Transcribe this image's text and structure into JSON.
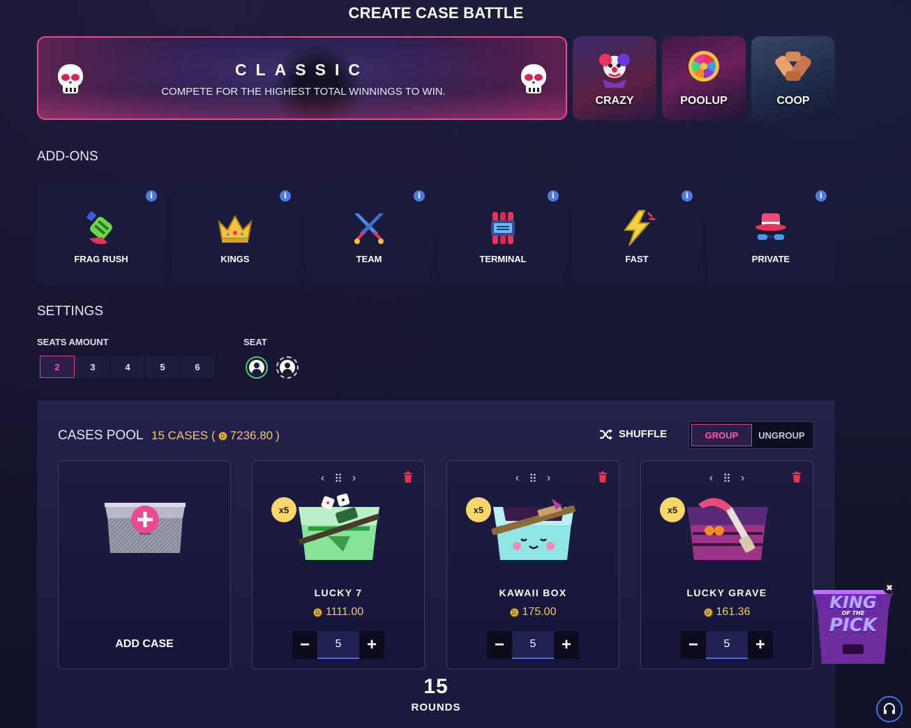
{
  "page": {
    "title": "CREATE CASE BATTLE"
  },
  "modes": {
    "classic": {
      "title": "CLASSIC",
      "subtitle": "COMPETE FOR THE HIGHEST TOTAL WINNINGS TO WIN."
    },
    "crazy": "CRAZY",
    "poolup": "POOLUP",
    "coop": "COOP"
  },
  "addons": {
    "heading": "ADD-ONS",
    "items": [
      {
        "label": "FRAG RUSH",
        "icon": "frag-rush-icon"
      },
      {
        "label": "KINGS",
        "icon": "crown-icon"
      },
      {
        "label": "TEAM",
        "icon": "crossed-swords-icon"
      },
      {
        "label": "TERMINAL",
        "icon": "terminal-bomb-icon"
      },
      {
        "label": "FAST",
        "icon": "lightning-icon"
      },
      {
        "label": "PRIVATE",
        "icon": "spy-hat-icon"
      }
    ],
    "info_glyph": "i"
  },
  "settings": {
    "heading": "SETTINGS",
    "seats_amount_label": "SEATS AMOUNT",
    "seat_label": "SEAT",
    "seat_options": [
      "2",
      "3",
      "4",
      "5",
      "6"
    ],
    "selected_seats": "2"
  },
  "pool": {
    "title": "CASES POOL",
    "count_prefix": "15 CASES (",
    "total": "7236.80",
    "count_suffix": ")",
    "shuffle_label": "SHUFFLE",
    "group_label": "GROUP",
    "ungroup_label": "UNGROUP",
    "add_case_label": "ADD CASE",
    "cases": [
      {
        "name": "LUCKY 7",
        "price": "1111.00",
        "multiplier": "x5",
        "quantity": "5",
        "accent": "#3cd65a"
      },
      {
        "name": "KAWAII BOX",
        "price": "175.00",
        "multiplier": "x5",
        "quantity": "5",
        "accent": "#5fd2d0"
      },
      {
        "name": "LUCKY GRAVE",
        "price": "161.36",
        "multiplier": "x5",
        "quantity": "5",
        "accent": "#b03a9a"
      }
    ],
    "rounds_count": "15",
    "rounds_label": "ROUNDS"
  },
  "promo": {
    "line1": "KING",
    "line2": "OF THE",
    "line3": "PICK",
    "close": "✖"
  },
  "colors": {
    "accent_pink": "#e84c8f",
    "gold": "#f4c86a",
    "info_blue": "#4a7be8",
    "green": "#3fcf75"
  }
}
